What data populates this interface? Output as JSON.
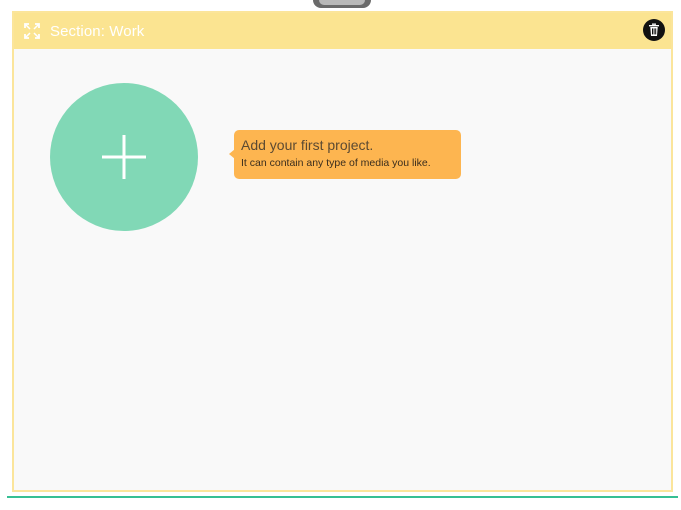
{
  "section": {
    "title": "Section: Work",
    "expand_icon": "expand-icon",
    "delete_icon": "trash-icon"
  },
  "project": {
    "add_icon": "plus-icon",
    "tooltip_title": "Add your first project.",
    "tooltip_subtitle": "It can contain any type of media you like."
  },
  "colors": {
    "header": "#fbe491",
    "add_button": "#81d8b6",
    "tooltip": "#fdb550",
    "accent_line": "#36bf93"
  }
}
